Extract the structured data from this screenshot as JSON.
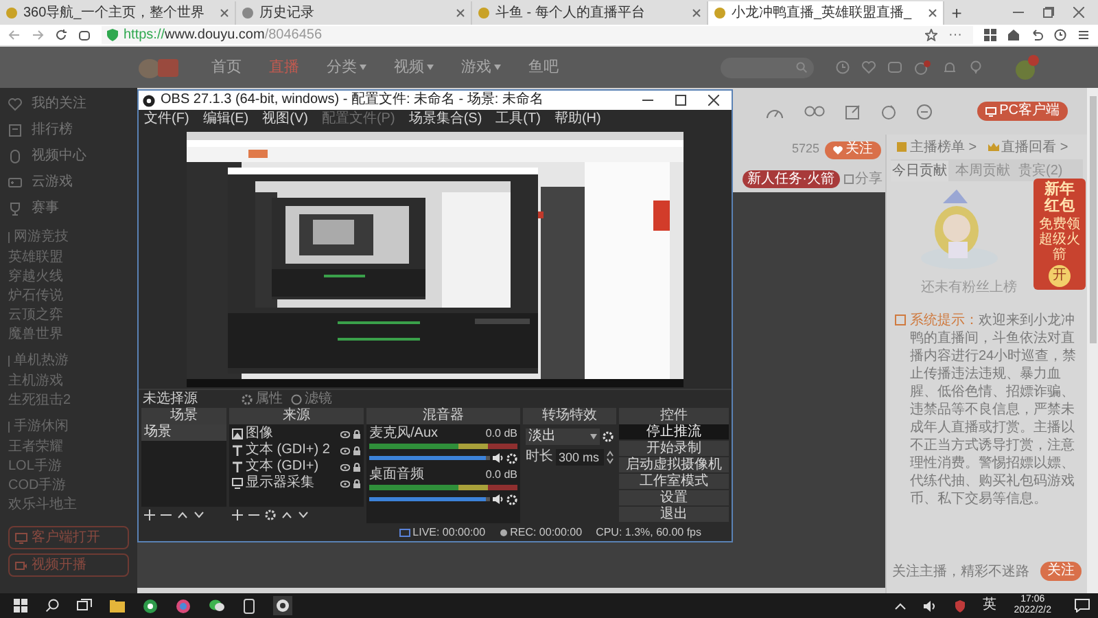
{
  "browser": {
    "tabs": [
      {
        "title": "360导航_一个主页，整个世界",
        "selected": false
      },
      {
        "title": "历史记录",
        "selected": false
      },
      {
        "title": "斗鱼 - 每个人的直播平台",
        "selected": false
      },
      {
        "title": "小龙冲鸭直播_英雄联盟直播_",
        "selected": true
      }
    ],
    "new_tab": "+",
    "url": {
      "scheme": "https://",
      "host": "www.douyu.com",
      "path": "/8046456"
    },
    "more": "···"
  },
  "site": {
    "nav": [
      {
        "label": "首页",
        "selected": false,
        "dropdown": false
      },
      {
        "label": "直播",
        "selected": true,
        "dropdown": false
      },
      {
        "label": "分类",
        "selected": false,
        "dropdown": true
      },
      {
        "label": "视频",
        "selected": false,
        "dropdown": true
      },
      {
        "label": "游戏",
        "selected": false,
        "dropdown": true
      },
      {
        "label": "鱼吧",
        "selected": false,
        "dropdown": false
      }
    ]
  },
  "sidebar": {
    "items": [
      "我的关注",
      "排行榜",
      "视频中心",
      "云游戏",
      "赛事"
    ],
    "sections": [
      {
        "title": "网游竞技",
        "items": [
          "英雄联盟",
          "穿越火线",
          "炉石传说",
          "云顶之弈",
          "魔兽世界"
        ]
      },
      {
        "title": "单机热游",
        "items": [
          "主机游戏",
          "生死狙击2"
        ]
      },
      {
        "title": "手游休闲",
        "items": [
          "王者荣耀",
          "LOL手游",
          "COD手游",
          "欢乐斗地主"
        ]
      }
    ],
    "buttons": [
      "客户端打开",
      "视频开播"
    ]
  },
  "obs": {
    "title": "OBS 27.1.3 (64-bit, windows) - 配置文件: 未命名 - 场景: 未命名",
    "menu": [
      {
        "label": "文件(F)",
        "disabled": false
      },
      {
        "label": "编辑(E)",
        "disabled": false
      },
      {
        "label": "视图(V)",
        "disabled": false
      },
      {
        "label": "配置文件(P)",
        "disabled": true
      },
      {
        "label": "场景集合(S)",
        "disabled": false
      },
      {
        "label": "工具(T)",
        "disabled": false
      },
      {
        "label": "帮助(H)",
        "disabled": false
      }
    ],
    "source_status": "未选择源",
    "source_buttons": [
      "属性",
      "滤镜"
    ],
    "scenes": {
      "title": "场景",
      "items": [
        {
          "label": "场景",
          "selected": true
        }
      ]
    },
    "sources": {
      "title": "来源",
      "items": [
        {
          "label": "图像",
          "kind": "image"
        },
        {
          "label": "文本 (GDI+) 2",
          "kind": "text"
        },
        {
          "label": "文本 (GDI+)",
          "kind": "text"
        },
        {
          "label": "显示器采集",
          "kind": "display"
        }
      ]
    },
    "mixer": {
      "title": "混音器",
      "channels": [
        {
          "name": "麦克风/Aux",
          "reading": "0.0 dB",
          "level": 0.97
        },
        {
          "name": "桌面音频",
          "reading": "0.0 dB",
          "level": 0.97
        }
      ]
    },
    "transitions": {
      "title": "转场特效",
      "value": "淡出",
      "duration_label": "时长",
      "duration": "300 ms"
    },
    "controls": {
      "title": "控件",
      "buttons": [
        {
          "label": "停止推流",
          "active": true
        },
        {
          "label": "开始录制",
          "active": false
        },
        {
          "label": "启动虚拟摄像机",
          "active": false
        },
        {
          "label": "工作室模式",
          "active": false
        },
        {
          "label": "设置",
          "active": false
        },
        {
          "label": "退出",
          "active": false
        }
      ]
    },
    "status": {
      "live": "LIVE: 00:00:00",
      "rec": "REC: 00:00:00",
      "cpu": "CPU: 1.3%, 60.00 fps"
    }
  },
  "room": {
    "pc_client": "PC客户端",
    "follower_count": "5725",
    "follow": "关注",
    "task_pill": "新人任务·火箭",
    "share": "分享"
  },
  "ranking": {
    "links": [
      "主播榜单 >",
      "直播回看 >"
    ],
    "tabs": [
      {
        "label": "今日贡献",
        "selected": true
      },
      {
        "label": "本周贡献",
        "selected": false
      },
      {
        "label": "贵宾(2)",
        "selected": false
      }
    ],
    "empty": "还未有粉丝上榜",
    "notice_label": "系统提示：",
    "notice": "欢迎来到小龙冲鸭的直播间，斗鱼依法对直播内容进行24小时巡查，禁止传播违法违规、暴力血腥、低俗色情、招嫖诈骗、违禁品等不良信息，严禁未成年人直播或打赏。主播以不正当方式诱导打赏，注意理性消费。警惕招嫖以嫖、代练代抽、购买礼包码游戏币、私下交易等信息。",
    "follow_prompt": "关注主播，精彩不迷路",
    "follow_button": "关注"
  },
  "red_packet": {
    "title": "新年红包",
    "subtitle": "免费领超级火箭",
    "open": "开"
  },
  "taskbar": {
    "ime": "英",
    "time": "17:06",
    "date": "2022/2/2"
  }
}
